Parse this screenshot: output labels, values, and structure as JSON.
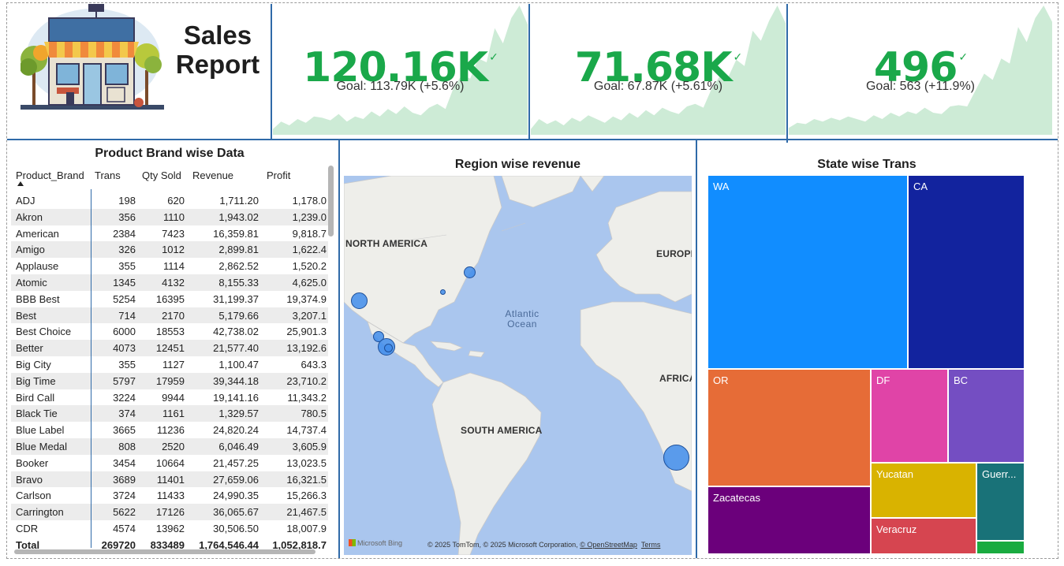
{
  "header": {
    "title": "Sales Report",
    "logo": "storefront-illustration"
  },
  "kpis": [
    {
      "value": "120.16K",
      "goal": "Goal: 113.79K (+5.6%)",
      "status_icon": "checkmark-icon",
      "trend": [
        0.02,
        0.08,
        0.05,
        0.1,
        0.07,
        0.12,
        0.11,
        0.09,
        0.14,
        0.08,
        0.12,
        0.1,
        0.16,
        0.12,
        0.18,
        0.14,
        0.2,
        0.15,
        0.13,
        0.19,
        0.22,
        0.18,
        0.35,
        0.45,
        0.42,
        0.58,
        0.55,
        0.82,
        0.7,
        0.9,
        1.0,
        0.85
      ]
    },
    {
      "value": "71.68K",
      "goal": "Goal: 67.87K (+5.61%)",
      "status_icon": "checkmark-icon",
      "trend": [
        0.02,
        0.1,
        0.06,
        0.09,
        0.05,
        0.11,
        0.08,
        0.13,
        0.1,
        0.07,
        0.12,
        0.09,
        0.15,
        0.11,
        0.17,
        0.13,
        0.19,
        0.16,
        0.14,
        0.2,
        0.22,
        0.19,
        0.34,
        0.44,
        0.43,
        0.57,
        0.52,
        0.8,
        0.72,
        0.88,
        1.0,
        0.86
      ]
    },
    {
      "value": "496",
      "goal": "Goal: 563 (+11.9%)",
      "status_icon": "checkmark-icon",
      "trend": [
        0.03,
        0.07,
        0.06,
        0.1,
        0.08,
        0.11,
        0.09,
        0.12,
        0.1,
        0.08,
        0.13,
        0.1,
        0.15,
        0.12,
        0.16,
        0.14,
        0.19,
        0.15,
        0.14,
        0.2,
        0.21,
        0.2,
        0.33,
        0.46,
        0.41,
        0.58,
        0.54,
        0.83,
        0.71,
        0.9,
        1.0,
        0.87
      ]
    }
  ],
  "brand_table": {
    "title": "Product Brand wise Data",
    "columns": [
      "Product_Brand",
      "Trans",
      "Qty Sold",
      "Revenue",
      "Profit"
    ],
    "rows": [
      [
        "ADJ",
        "198",
        "620",
        "1,711.20",
        "1,178.0"
      ],
      [
        "Akron",
        "356",
        "1110",
        "1,943.02",
        "1,239.0"
      ],
      [
        "American",
        "2384",
        "7423",
        "16,359.81",
        "9,818.7"
      ],
      [
        "Amigo",
        "326",
        "1012",
        "2,899.81",
        "1,622.4"
      ],
      [
        "Applause",
        "355",
        "1114",
        "2,862.52",
        "1,520.2"
      ],
      [
        "Atomic",
        "1345",
        "4132",
        "8,155.33",
        "4,625.0"
      ],
      [
        "BBB Best",
        "5254",
        "16395",
        "31,199.37",
        "19,374.9"
      ],
      [
        "Best",
        "714",
        "2170",
        "5,179.66",
        "3,207.1"
      ],
      [
        "Best Choice",
        "6000",
        "18553",
        "42,738.02",
        "25,901.3"
      ],
      [
        "Better",
        "4073",
        "12451",
        "21,577.40",
        "13,192.6"
      ],
      [
        "Big City",
        "355",
        "1127",
        "1,100.47",
        "643.3"
      ],
      [
        "Big Time",
        "5797",
        "17959",
        "39,344.18",
        "23,710.2"
      ],
      [
        "Bird Call",
        "3224",
        "9944",
        "19,141.16",
        "11,343.2"
      ],
      [
        "Black Tie",
        "374",
        "1161",
        "1,329.57",
        "780.5"
      ],
      [
        "Blue Label",
        "3665",
        "11236",
        "24,820.24",
        "14,737.4"
      ],
      [
        "Blue Medal",
        "808",
        "2520",
        "6,046.49",
        "3,605.9"
      ],
      [
        "Booker",
        "3454",
        "10664",
        "21,457.25",
        "13,023.5"
      ],
      [
        "Bravo",
        "3689",
        "11401",
        "27,659.06",
        "16,321.5"
      ],
      [
        "Carlson",
        "3724",
        "11433",
        "24,990.35",
        "15,266.3"
      ],
      [
        "Carrington",
        "5622",
        "17126",
        "36,065.67",
        "21,467.5"
      ],
      [
        "CDR",
        "4574",
        "13962",
        "30,506.50",
        "18,007.9"
      ]
    ],
    "total": [
      "Total",
      "269720",
      "833489",
      "1,764,546.44",
      "1,052,818.7"
    ]
  },
  "map": {
    "title": "Region wise revenue",
    "labels": {
      "na": "NORTH AMERICA",
      "eu": "EUROPE",
      "af": "AFRICA",
      "sa": "SOUTH AMERICA",
      "ocean": "Atlantic Ocean"
    },
    "attribution": "© 2025 TomTom, © 2025 Microsoft Corporation,",
    "osm_link": "© OpenStreetMap",
    "terms_link": "Terms",
    "provider": "Microsoft Bing"
  },
  "treemap": {
    "title": "State wise Trans",
    "items": [
      {
        "label": "WA",
        "color": "#118dff"
      },
      {
        "label": "CA",
        "color": "#12239e"
      },
      {
        "label": "OR",
        "color": "#e66c37"
      },
      {
        "label": "DF",
        "color": "#e044a7"
      },
      {
        "label": "BC",
        "color": "#744ec2"
      },
      {
        "label": "Yucatan",
        "color": "#d9b300"
      },
      {
        "label": "Guerr...",
        "color": "#197278"
      },
      {
        "label": "Zacatecas",
        "color": "#6b007b"
      },
      {
        "label": "Veracruz",
        "color": "#d64550"
      },
      {
        "label": "",
        "color": "#1aab40"
      }
    ]
  },
  "colors": {
    "kpi_green": "#1aa84a",
    "spark_fill": "#cdebd6",
    "divider": "#2f6aa8"
  }
}
